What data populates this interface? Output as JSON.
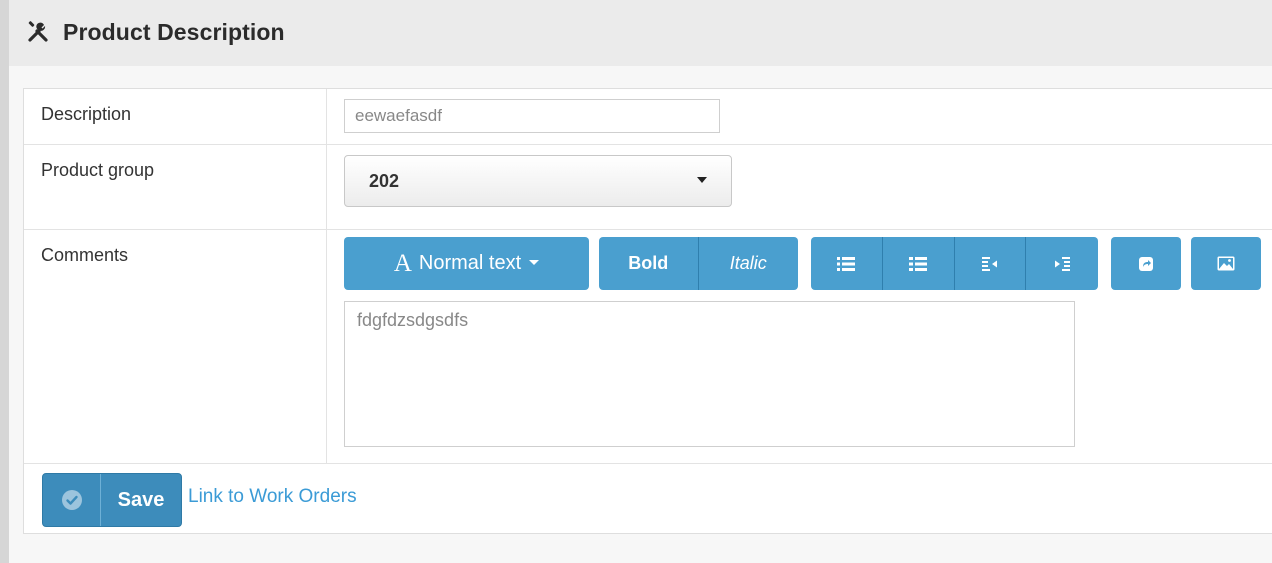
{
  "panel": {
    "title": "Product Description",
    "title_icon": "tools-icon"
  },
  "form": {
    "description": {
      "label": "Description",
      "value": "eewaefasdf"
    },
    "product_group": {
      "label": "Product group",
      "selected": "202"
    },
    "comments": {
      "label": "Comments",
      "value": "fdgfdzsdgsdfs",
      "toolbar": {
        "font_glyph": "A",
        "font_label": "Normal text",
        "bold_label": "Bold",
        "italic_label": "Italic",
        "list_icons": [
          "unordered-list-icon",
          "ordered-list-icon",
          "outdent-icon",
          "indent-icon"
        ],
        "link_icon": "link-icon",
        "image_icon": "image-icon"
      }
    }
  },
  "actions": {
    "save_label": "Save",
    "save_icon": "check-circle-icon",
    "link_label": "Link to Work Orders"
  },
  "colors": {
    "toolbar_button": "#4a9fcf",
    "save_button": "#3d8cbb",
    "link": "#3b9bd6"
  }
}
